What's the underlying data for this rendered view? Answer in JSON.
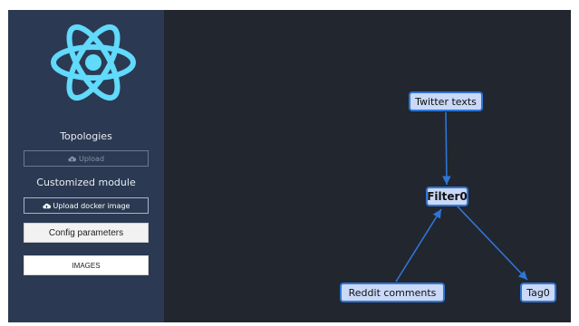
{
  "sidebar": {
    "topologies_heading": "Topologies",
    "upload_label": "Upload",
    "customized_module_heading": "Customized module",
    "upload_docker_label": "Upload docker image",
    "config_parameters_label": "Config parameters",
    "images_label": "IMAGES"
  },
  "graph": {
    "nodes": {
      "twitter": "Twitter texts",
      "filter": "Filter0",
      "reddit": "Reddit comments",
      "tag": "Tag0"
    }
  },
  "colors": {
    "sidebar_bg": "#2b3a52",
    "canvas_bg": "#22262e",
    "logo": "#61dafb",
    "node_fill": "#c9d9f7",
    "node_border": "#2f75d8",
    "edge": "#2f75d8"
  },
  "icons": [
    "react-logo-icon",
    "cloud-upload-icon"
  ]
}
